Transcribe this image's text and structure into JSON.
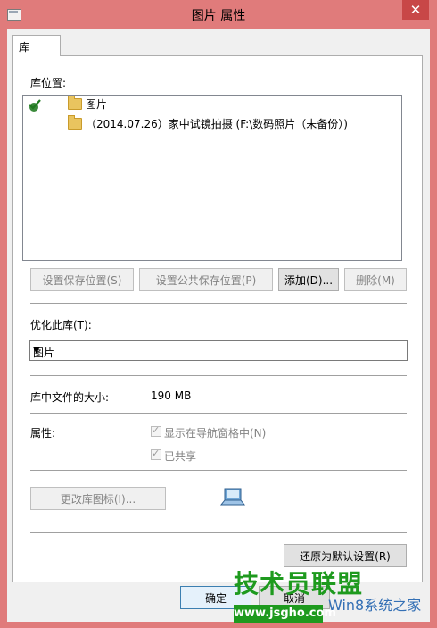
{
  "window": {
    "title": "图片 属性",
    "close_glyph": "✕"
  },
  "tabs": [
    {
      "label": "库"
    }
  ],
  "library_locations": {
    "label": "库位置:",
    "items": [
      {
        "label": "图片",
        "default_save": true
      },
      {
        "label": "（2014.07.26）家中试镜拍摄 (F:\\数码照片（未备份）)"
      }
    ]
  },
  "buttons": {
    "set_save": "设置保存位置(S)",
    "set_public_save": "设置公共保存位置(P)",
    "add": "添加(D)...",
    "remove": "删除(M)",
    "change_icon": "更改库图标(I)...",
    "restore": "还原为默认设置(R)",
    "ok": "确定",
    "cancel": "取消"
  },
  "optimize": {
    "label": "优化此库(T):",
    "value": "图片"
  },
  "size": {
    "label": "库中文件的大小:",
    "value": "190 MB"
  },
  "attributes": {
    "label": "属性:",
    "show_in_nav": {
      "label": "显示在导航窗格中(N)",
      "checked": true
    },
    "shared": {
      "label": "已共享",
      "checked": true
    }
  },
  "watermark": {
    "line1": "技术员联盟",
    "line2": "www.jsgho.com",
    "line3": "Win8系统之家"
  }
}
